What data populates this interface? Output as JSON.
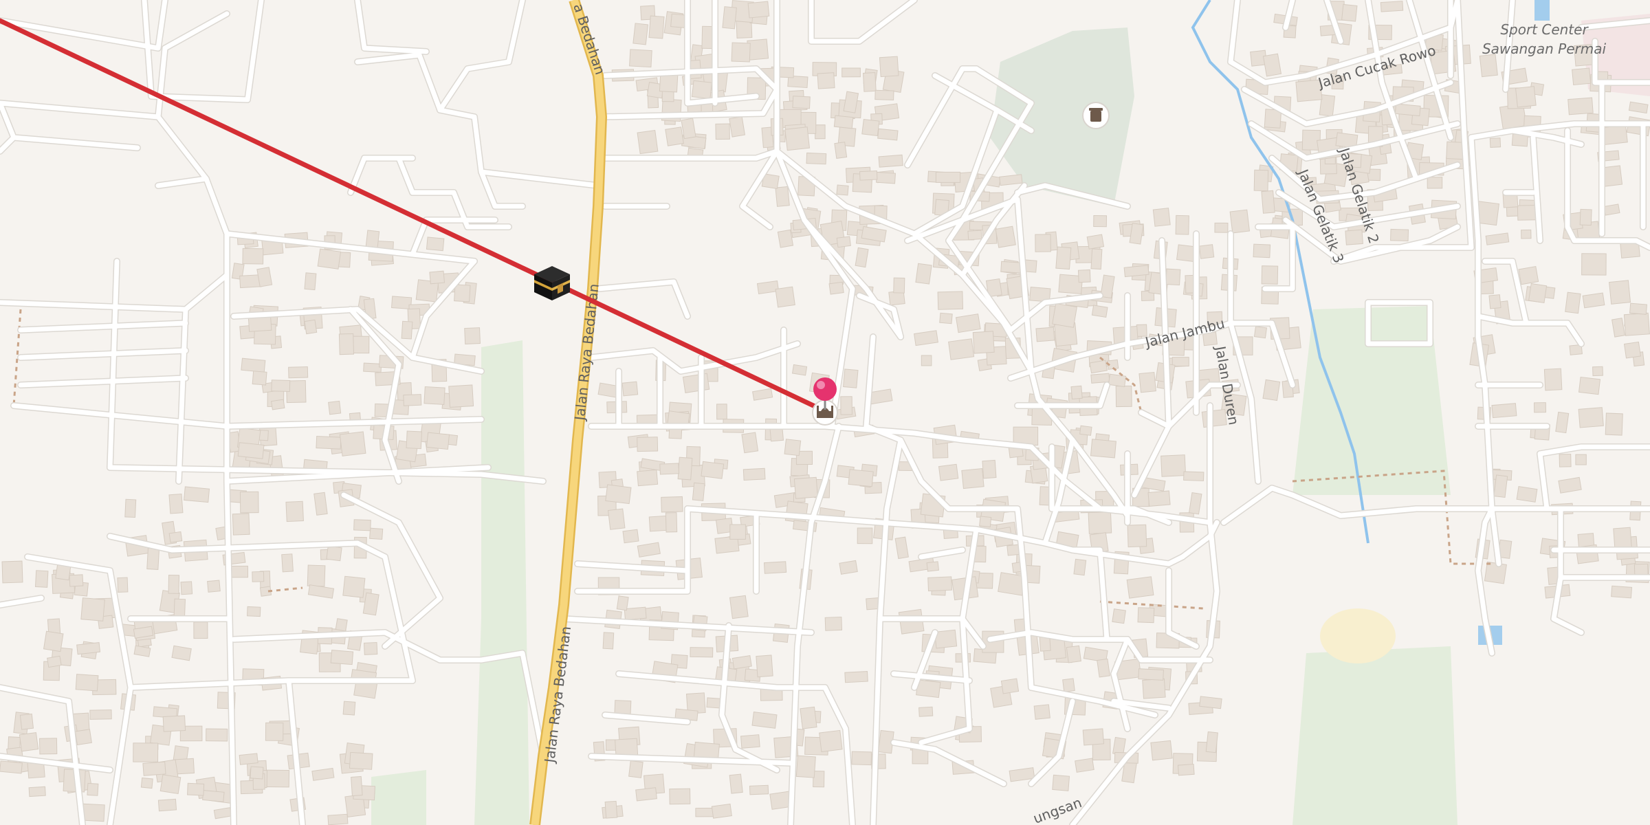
{
  "colors": {
    "land": "#f6f3ef",
    "road": "#ffffff",
    "road_casing": "#dcd8d2",
    "primary_road": "#f7d67c",
    "primary_casing": "#e2b74e",
    "building": "#e7dfd6",
    "building_stroke": "#d6ccc1",
    "park": "#e3eddc",
    "cemetery": "#dfe6dc",
    "sport_area": "#f8efcf",
    "water": "#8fc3ec",
    "footpath": "#c9a488",
    "qibla_line": "#d42e34",
    "pin": "#e5336e"
  },
  "labels": {
    "road_bedahan_top": "a Bedahan",
    "road_bedahan_mid": "Jalan Raya Bedahan",
    "road_bedahan_bottom": "Jalan Raya Bedahan",
    "road_cucak_rowo": "Jalan Cucak Rowo",
    "road_gelatik_2": "Jalan Gelatik 2",
    "road_gelatik_3": "Jalan Gelatik 3",
    "road_jambu": "Jalan Jambu",
    "road_duren": "Jalan Duren",
    "road_bottom_partial": "ungsan",
    "poi_sport_center": "Sport Center",
    "poi_sawangan_permai": "Sawangan Permai"
  },
  "markers": {
    "kaaba_icon": "kaaba-icon",
    "location_pin": "location-pin-icon",
    "mosque_icon": "mosque-icon",
    "cemetery_icon": "cemetery-icon"
  }
}
